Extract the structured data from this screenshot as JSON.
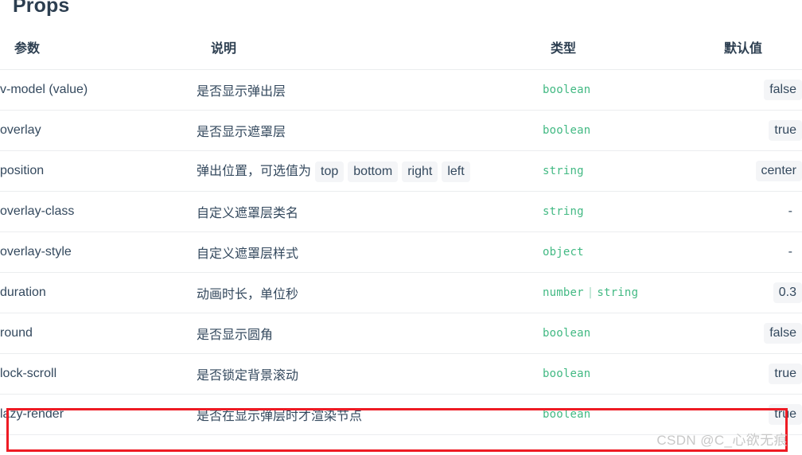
{
  "page_title": "Props",
  "table": {
    "headers": {
      "param": "参数",
      "desc": "说明",
      "type": "类型",
      "default": "默认值"
    },
    "rows": [
      {
        "param": "v-model (value)",
        "desc": "是否显示弹出层",
        "desc_chips": [],
        "type": "boolean",
        "type_union": null,
        "default": "false",
        "default_is_chip": true
      },
      {
        "param": "overlay",
        "desc": "是否显示遮罩层",
        "desc_chips": [],
        "type": "boolean",
        "type_union": null,
        "default": "true",
        "default_is_chip": true
      },
      {
        "param": "position",
        "desc": "弹出位置，可选值为",
        "desc_chips": [
          "top",
          "bottom",
          "right",
          "left"
        ],
        "type": "string",
        "type_union": null,
        "default": "center",
        "default_is_chip": true
      },
      {
        "param": "overlay-class",
        "desc": "自定义遮罩层类名",
        "desc_chips": [],
        "type": "string",
        "type_union": null,
        "default": "-",
        "default_is_chip": false
      },
      {
        "param": "overlay-style",
        "desc": "自定义遮罩层样式",
        "desc_chips": [],
        "type": "object",
        "type_union": null,
        "default": "-",
        "default_is_chip": false
      },
      {
        "param": "duration",
        "desc": "动画时长，单位秒",
        "desc_chips": [],
        "type": "number",
        "type_union": "string",
        "type_separator": "|",
        "default": "0.3",
        "default_is_chip": true
      },
      {
        "param": "round",
        "desc": "是否显示圆角",
        "desc_chips": [],
        "type": "boolean",
        "type_union": null,
        "default": "false",
        "default_is_chip": true
      },
      {
        "param": "lock-scroll",
        "desc": "是否锁定背景滚动",
        "desc_chips": [],
        "type": "boolean",
        "type_union": null,
        "default": "true",
        "default_is_chip": true
      },
      {
        "param": "lazy-render",
        "desc": "是否在显示弹层时才渲染节点",
        "desc_chips": [],
        "type": "boolean",
        "type_union": null,
        "default": "true",
        "default_is_chip": true,
        "highlighted": true
      }
    ]
  },
  "annotation": {
    "highlight_color": "#ee1b24",
    "target_row": "lazy-render"
  },
  "watermark": {
    "text": "CSDN @C_心欲无痕",
    "color": "#c8c8c8"
  },
  "colors": {
    "text": "#34495e",
    "heading": "#2c3e50",
    "type_green": "#42b983",
    "chip_bg": "#f4f5f7",
    "row_border": "#ebedef"
  }
}
